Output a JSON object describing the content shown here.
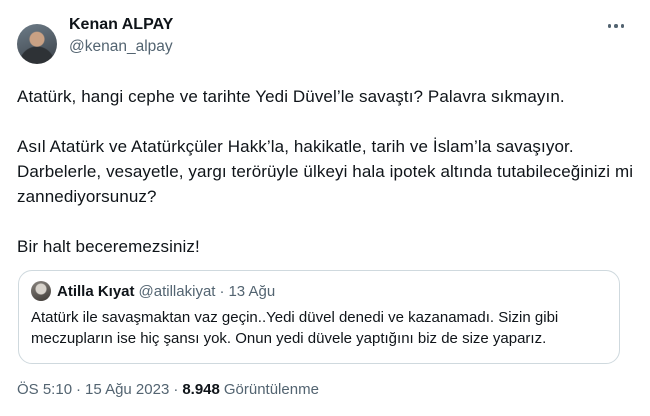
{
  "tweet": {
    "author": {
      "display_name": "Kenan ALPAY",
      "handle": "@kenan_alpay"
    },
    "more_icon": "more-horizontal-icon",
    "paragraphs": [
      "Atatürk, hangi cephe ve tarihte Yedi Düvel’le savaştı? Palavra sıkmayın.",
      "Asıl Atatürk ve Atatürkçüler Hakk’la, hakikatle, tarih ve İslam’la savaşıyor. Darbelerle, vesayetle, yargı terörüyle ülkeyi hala ipotek altında tutabileceğinizi mi zannediyorsunuz?",
      "Bir halt beceremezsiniz!"
    ],
    "quoted": {
      "display_name": "Atilla Kıyat",
      "handle": "@atillakiyat",
      "separator": "·",
      "date": "13 Ağu",
      "text": "Atatürk ile savaşmaktan vaz geçin..Yedi düvel denedi ve kazanamadı. Sizin gibi meczupların ise hiç şansı yok. Onun yedi düvele yaptığını biz de size yaparız."
    },
    "meta": {
      "time": "ÖS 5:10",
      "separator": "·",
      "date": "15 Ağu 2023",
      "views_count": "8.948",
      "views_label": "Görüntülenme"
    }
  },
  "colors": {
    "text_primary": "#0f1419",
    "text_secondary": "#536471",
    "border": "#cfd9de"
  }
}
